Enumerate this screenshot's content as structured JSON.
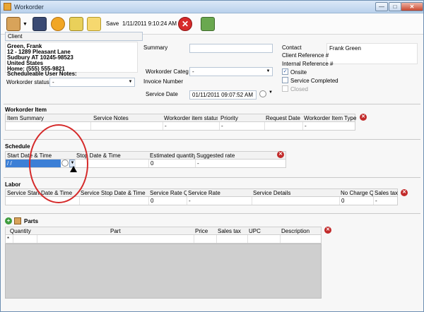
{
  "window": {
    "title": "Workorder",
    "buttons": {
      "minimize": "—",
      "maximize": "□",
      "close": "✕"
    }
  },
  "toolbar": {
    "save_label": "Save",
    "timestamp": "1/11/2011 9:10:24 AM"
  },
  "client": {
    "tab_label": "Client",
    "details": [
      "Green, Frank",
      "12 - 1289 Pleasant Lane",
      "Sudbury AT 10245-98523",
      "United States",
      "Home: (555) 555-9821",
      "Scheduleable User Notes:"
    ]
  },
  "workorder_status": {
    "label": "Workorder status",
    "value": "-"
  },
  "summary": {
    "label": "Summary",
    "value": ""
  },
  "workorder_category": {
    "label": "Workorder Categ",
    "value": "-"
  },
  "invoice_number": {
    "label": "Invoice Number"
  },
  "service_date": {
    "label": "Service Date",
    "value": "01/11/2011 09:07:52 AM"
  },
  "contact": {
    "label": "Contact",
    "value": "Frank Green"
  },
  "client_reference": {
    "label": "Client Reference #"
  },
  "internal_reference": {
    "label": "Internal Reference #"
  },
  "checks": {
    "onsite": {
      "label": "Onsite",
      "checked": true
    },
    "service_completed": {
      "label": "Service Completed",
      "checked": false
    },
    "closed": {
      "label": "Closed",
      "checked": false
    }
  },
  "workorder_item": {
    "title": "Workorder Item",
    "columns": [
      "Item Summary",
      "Service Notes",
      "Workorder item status",
      "Priority",
      "Request Date",
      "Workorder Item Type"
    ],
    "row": [
      "",
      "",
      "-",
      "-",
      "",
      "-"
    ]
  },
  "schedule": {
    "title": "Schedule",
    "columns": [
      "Start Date & Time",
      "Stop Date & Time",
      "Estimated quantity",
      "Suggested rate"
    ],
    "row": [
      "/ /",
      "",
      "0",
      "-"
    ]
  },
  "labor": {
    "title": "Labor",
    "columns": [
      "Service Start Date & Time",
      "Service Stop Date & Time",
      "Service Rate Q",
      "Service Rate",
      "Service Details",
      "No Charge Q",
      "Sales tax"
    ],
    "row": [
      "",
      "",
      "0",
      "-",
      "",
      "0",
      "-"
    ]
  },
  "parts": {
    "title": "Parts",
    "columns": [
      "Quantity",
      "Part",
      "Price",
      "Sales tax",
      "UPC",
      "Description"
    ],
    "new_row_marker": "*"
  },
  "colors": {
    "accent": "#3c7fd6",
    "highlight": "#d52a2a",
    "delete": "#c22b2b"
  }
}
